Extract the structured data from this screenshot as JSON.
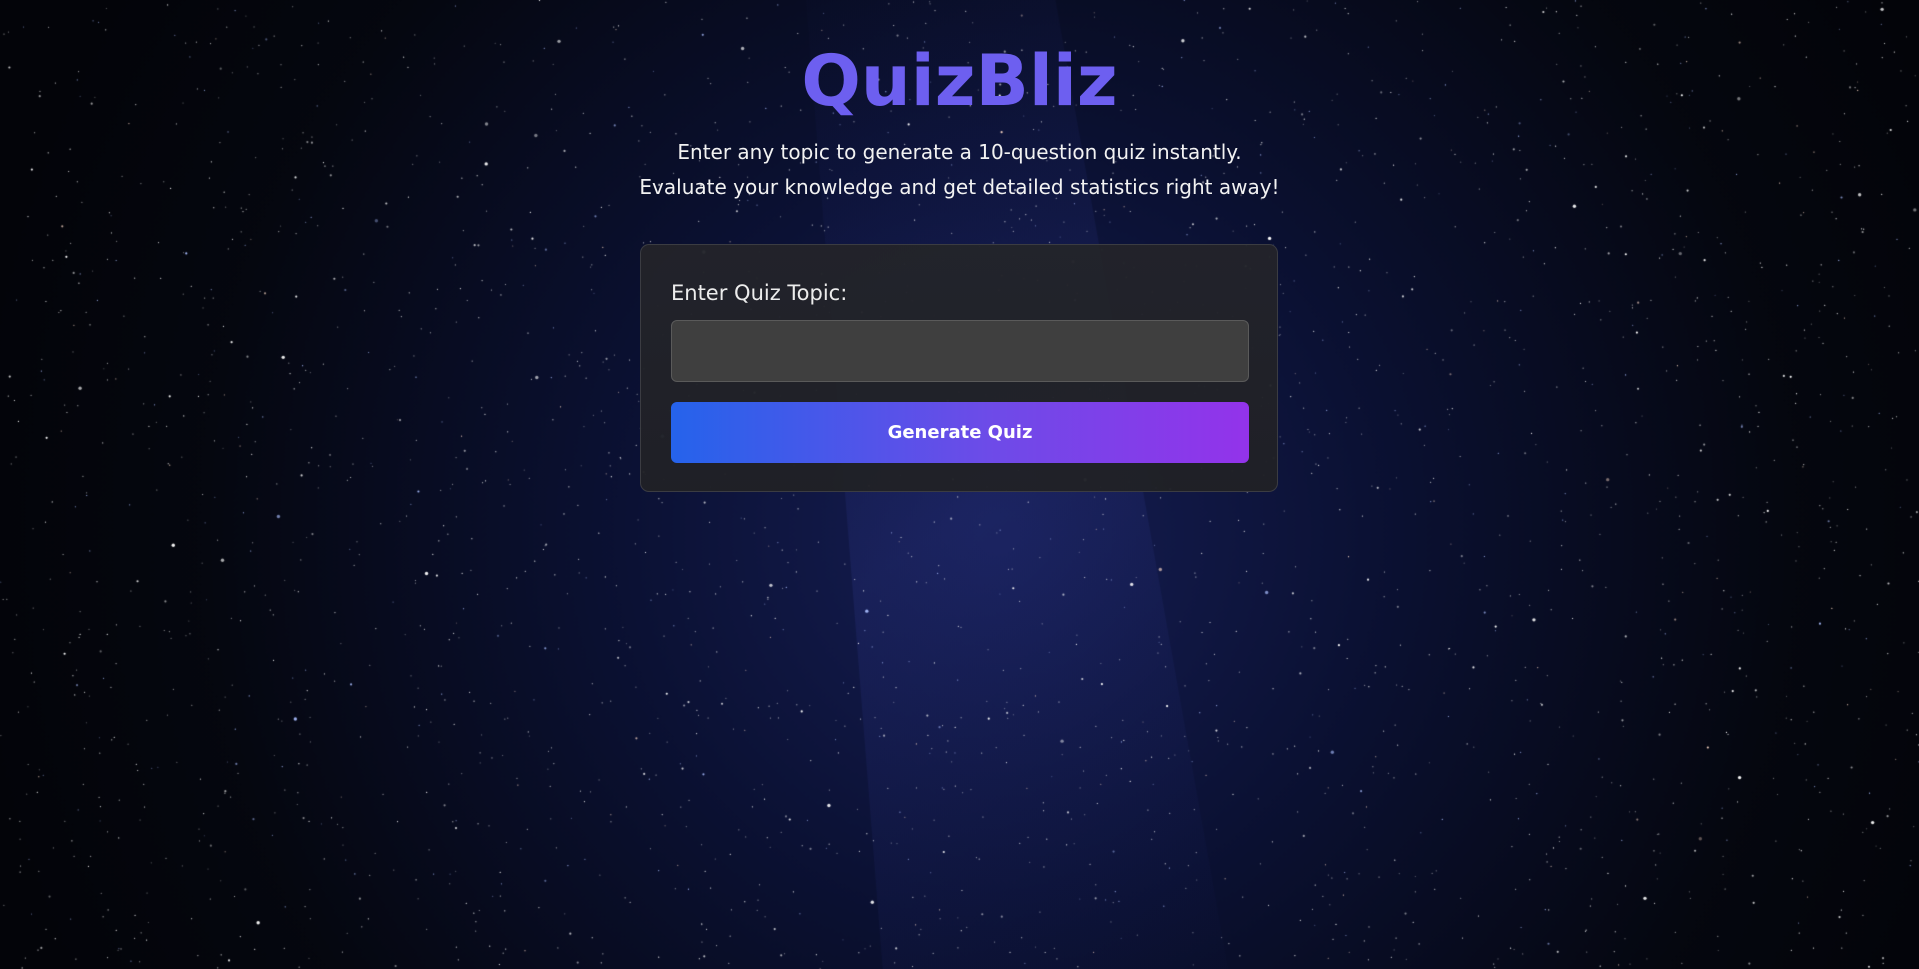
{
  "app": {
    "title": "QuizBliz",
    "tagline_line1": "Enter any topic to generate a 10-question quiz instantly.",
    "tagline_line2": "Evaluate your knowledge and get detailed statistics right away!"
  },
  "form": {
    "topic_label": "Enter Quiz Topic:",
    "topic_value": "",
    "topic_placeholder": "",
    "generate_label": "Generate Quiz"
  },
  "colors": {
    "title": "#6d5ff0",
    "button_gradient_start": "#2563eb",
    "button_gradient_end": "#9333ea",
    "card_background": "#222328",
    "input_background": "#3f3f3f"
  },
  "background": {
    "style": "starry-night-sky"
  }
}
